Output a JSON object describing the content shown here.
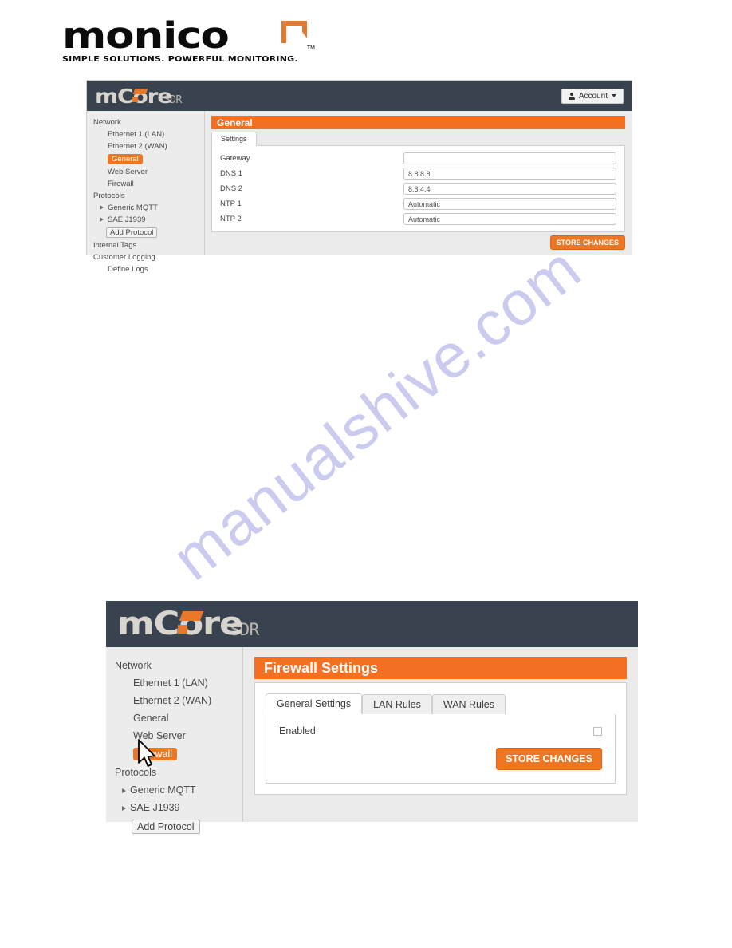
{
  "brand": {
    "logo_word": "monico",
    "logo_tagline": "SIMPLE SOLUTIONS. POWERFUL MONITORING.",
    "logo_tm": "TM",
    "accent_orange": "#e8792a",
    "accent_black": "#0b0b0b"
  },
  "watermark": {
    "text": "manualshive.com",
    "color": "#c9c9ef"
  },
  "shot1": {
    "header": {
      "product_word": "mCore",
      "product_suffix": "SDR",
      "account_label": "Account",
      "account_icon": "person-icon",
      "caret_icon": "chevron-down-icon"
    },
    "sidebar": {
      "items": [
        {
          "label": "Network",
          "level": "group",
          "selected": false,
          "arrow": false
        },
        {
          "label": "Ethernet 1 (LAN)",
          "level": "child",
          "selected": false,
          "arrow": false
        },
        {
          "label": "Ethernet 2 (WAN)",
          "level": "child",
          "selected": false,
          "arrow": false
        },
        {
          "label": "General",
          "level": "child",
          "selected": true,
          "arrow": false
        },
        {
          "label": "Web Server",
          "level": "child",
          "selected": false,
          "arrow": false
        },
        {
          "label": "Firewall",
          "level": "child",
          "selected": false,
          "arrow": false
        },
        {
          "label": "Protocols",
          "level": "group",
          "selected": false,
          "arrow": false
        },
        {
          "label": "Generic MQTT",
          "level": "child",
          "selected": false,
          "arrow": true
        },
        {
          "label": "SAE J1939",
          "level": "child",
          "selected": false,
          "arrow": true
        },
        {
          "label": "Add Protocol",
          "level": "button",
          "selected": false,
          "arrow": false
        },
        {
          "label": "Internal Tags",
          "level": "group",
          "selected": false,
          "arrow": false
        },
        {
          "label": "Customer Logging",
          "level": "group",
          "selected": false,
          "arrow": false
        },
        {
          "label": "Define Logs",
          "level": "child",
          "selected": false,
          "arrow": false
        }
      ]
    },
    "page_title": "General",
    "tabs": [
      {
        "label": "Settings",
        "active": true
      }
    ],
    "form": {
      "fields": [
        {
          "label": "Gateway",
          "value": ""
        },
        {
          "label": "DNS 1",
          "value": "8.8.8.8"
        },
        {
          "label": "DNS 2",
          "value": "8.8.4.4"
        },
        {
          "label": "NTP 1",
          "value": "Automatic"
        },
        {
          "label": "NTP 2",
          "value": "Automatic"
        }
      ]
    },
    "store_button": "STORE CHANGES"
  },
  "shot2": {
    "header": {
      "product_word": "mCore",
      "product_suffix": "SDR"
    },
    "sidebar": {
      "items": [
        {
          "label": "Network",
          "level": "group",
          "selected": false,
          "arrow": false
        },
        {
          "label": "Ethernet 1 (LAN)",
          "level": "child",
          "selected": false,
          "arrow": false
        },
        {
          "label": "Ethernet 2 (WAN)",
          "level": "child",
          "selected": false,
          "arrow": false
        },
        {
          "label": "General",
          "level": "child",
          "selected": false,
          "arrow": false
        },
        {
          "label": "Web Server",
          "level": "child",
          "selected": false,
          "arrow": false
        },
        {
          "label": "Firewall",
          "level": "child",
          "selected": true,
          "arrow": false
        },
        {
          "label": "Protocols",
          "level": "group",
          "selected": false,
          "arrow": false
        },
        {
          "label": "Generic MQTT",
          "level": "child",
          "selected": false,
          "arrow": true
        },
        {
          "label": "SAE J1939",
          "level": "child",
          "selected": false,
          "arrow": true
        },
        {
          "label": "Add Protocol",
          "level": "button",
          "selected": false,
          "arrow": false
        }
      ]
    },
    "page_title": "Firewall Settings",
    "tabs": [
      {
        "label": "General Settings",
        "active": true
      },
      {
        "label": "LAN Rules",
        "active": false
      },
      {
        "label": "WAN Rules",
        "active": false
      }
    ],
    "enabled_label": "Enabled",
    "enabled_checked": false,
    "store_button": "STORE CHANGES"
  },
  "cursor": {
    "icon": "mouse-pointer-icon"
  }
}
